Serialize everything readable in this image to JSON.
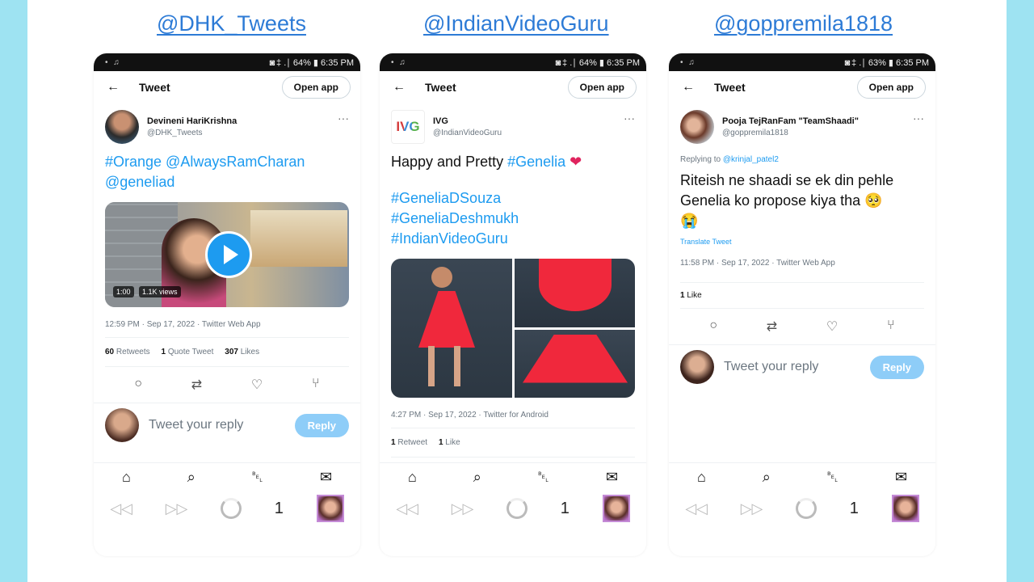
{
  "handles": [
    "@DHK_Tweets",
    "@IndianVideoGuru",
    "@goppremila1818"
  ],
  "status": {
    "left": "• ♫",
    "right_1": "◙ ‡ .∣ 64% ▮ 6:35 PM",
    "right_2": "◙ ‡ .∣ 64% ▮ 6:35 PM",
    "right_3": "◙ ‡ .∣ 63% ▮ 6:35 PM"
  },
  "common": {
    "back": "←",
    "title": "Tweet",
    "open_app": "Open app",
    "more": "···",
    "reply_placeholder": "Tweet your reply",
    "reply_button": "Reply",
    "page_num": "1"
  },
  "phone1": {
    "display_name": "Devineni HariKrishna",
    "username": "@DHK_Tweets",
    "text_line1": "#Orange @AlwaysRamCharan",
    "text_line2": "@geneliad",
    "video_duration": "1:00",
    "video_views": "1.1K views",
    "meta": "12:59 PM · Sep 17, 2022 · Twitter Web App",
    "retweets_count": "60",
    "retweets_label": "Retweets",
    "quote_count": "1",
    "quote_label": "Quote Tweet",
    "likes_count": "307",
    "likes_label": "Likes"
  },
  "phone2": {
    "display_name": "IVG",
    "username": "@IndianVideoGuru",
    "logo_text": "IVG",
    "text_plain": "Happy and Pretty ",
    "text_hash": "#Genelia",
    "heart": "❤",
    "tag1": "#GeneliaDSouza",
    "tag2": "#GeneliaDeshmukh",
    "tag3": "#IndianVideoGuru",
    "meta": "4:27 PM · Sep 17, 2022 · Twitter for Android",
    "retweet_count": "1",
    "retweet_label": "Retweet",
    "like_count": "1",
    "like_label": "Like"
  },
  "phone3": {
    "display_name": "Pooja TejRanFam \"TeamShaadi\"",
    "username": "@goppremila1818",
    "replying_prefix": "Replying to ",
    "replying_to": "@krinjal_patel2",
    "text_line1": "Riteish ne shaadi se ek din pehle",
    "text_line2": "Genelia ko propose kiya tha 🥺",
    "text_line3": "😭",
    "translate": "Translate Tweet",
    "meta": "11:58 PM · Sep 17, 2022 · Twitter Web App",
    "likes_count": "1",
    "likes_label": "Like"
  },
  "icons": {
    "reply": "○",
    "retweet": "⇄",
    "like": "♡",
    "share": "⑂",
    "home": "⌂",
    "search": "⌕",
    "bell": "␇",
    "mail": "✉",
    "rewind": "◁◁",
    "forward": "▷▷"
  },
  "colors": {
    "accent": "#1d9bf0",
    "handle_text": "#2d7bd6",
    "frame": "#9ee3f2",
    "dress": "#f0283c"
  }
}
